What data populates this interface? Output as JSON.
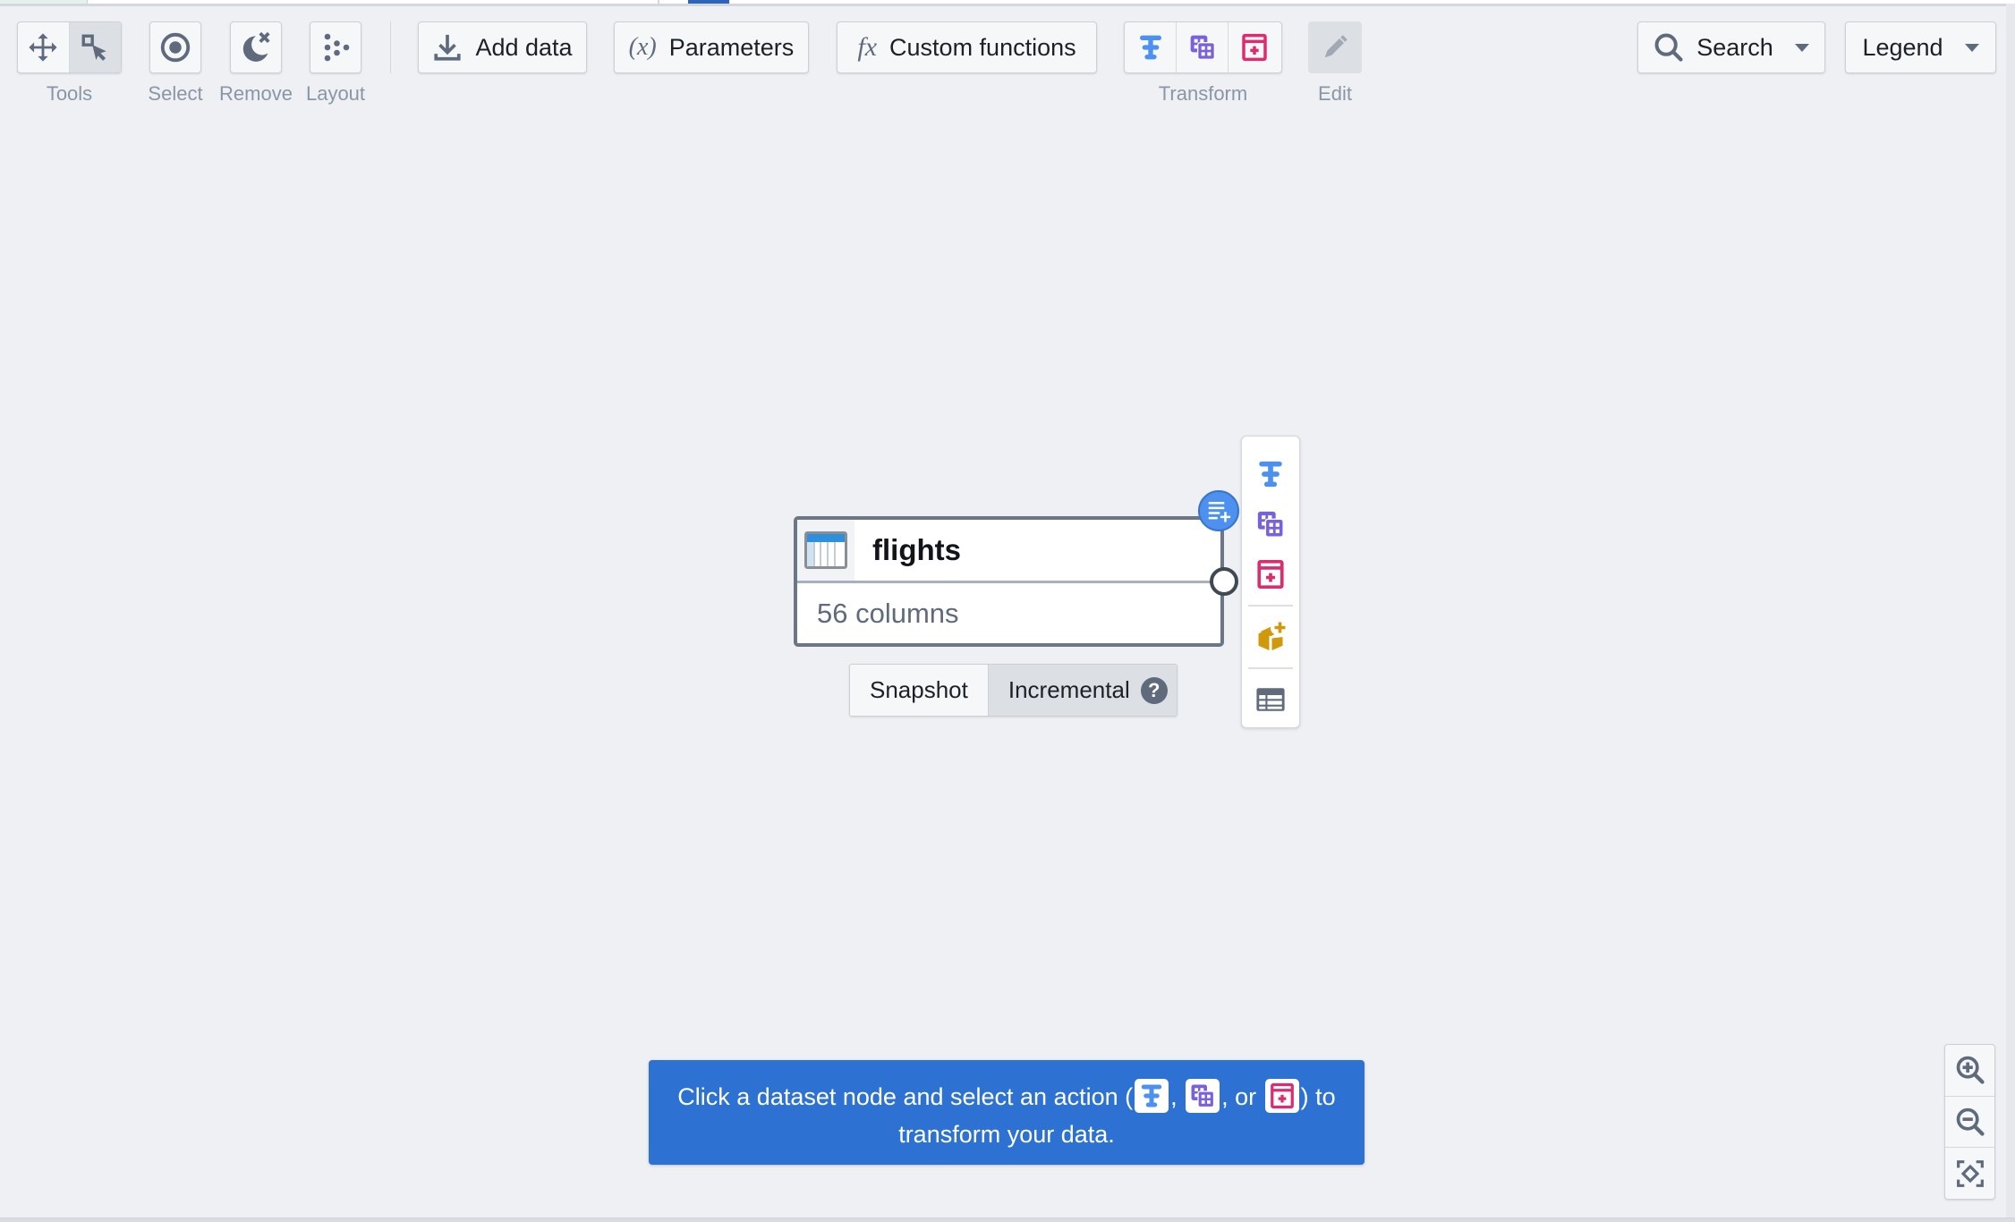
{
  "toolbar": {
    "tools_label": "Tools",
    "tools": [
      {
        "name": "pan",
        "icon": "move-icon",
        "active": false
      },
      {
        "name": "select-pointer",
        "icon": "select-pointer-icon",
        "active": true
      }
    ],
    "select_label": "Select",
    "remove_label": "Remove",
    "layout_label": "Layout",
    "add_data_label": "Add data",
    "parameters_label": "Parameters",
    "parameters_glyph": "(x)",
    "custom_functions_label": "Custom functions",
    "custom_functions_glyph": "fx",
    "transform_label": "Transform",
    "transform_actions": [
      {
        "name": "transform-path",
        "icon": "transform-path-icon",
        "color": "#4c90f0"
      },
      {
        "name": "join",
        "icon": "join-icon",
        "color": "#7961db"
      },
      {
        "name": "union",
        "icon": "union-icon",
        "color": "#db2c6f"
      }
    ],
    "edit_label": "Edit",
    "search_label": "Search",
    "legend_label": "Legend"
  },
  "node": {
    "title": "flights",
    "subtitle": "56 columns",
    "modes": [
      "Snapshot",
      "Incremental"
    ],
    "selected_mode": "Incremental",
    "help_glyph": "?"
  },
  "side_actions": [
    {
      "name": "transform-path",
      "icon": "transform-path-icon",
      "color": "#4c90f0"
    },
    {
      "name": "join",
      "icon": "join-icon",
      "color": "#7961db"
    },
    {
      "name": "union",
      "icon": "union-icon",
      "color": "#db2c6f"
    },
    {
      "name": "add-object",
      "icon": "cube-add-icon",
      "color": "#d1980b"
    },
    {
      "name": "preview-table",
      "icon": "table-icon",
      "color": "#5f6b7c"
    }
  ],
  "banner": {
    "text_before": "Click a dataset node and select an action (",
    "sep1": ",",
    "sep2": ", or",
    "text_after": ") to transform your data."
  },
  "colors": {
    "accent_blue": "#2d72d2",
    "transform_blue": "#4c90f0",
    "join_purple": "#7961db",
    "union_pink": "#db2c6f",
    "object_gold": "#d1980b"
  }
}
